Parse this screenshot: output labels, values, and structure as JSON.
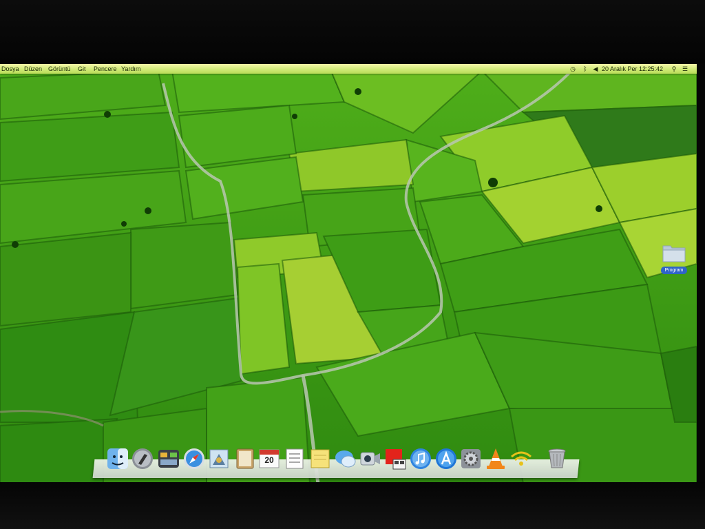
{
  "menubar": {
    "items": [
      "Dosya",
      "Düzen",
      "Görüntü",
      "Git",
      "Pencere",
      "Yardım"
    ],
    "clock": "20 Aralık Per  12:25:42"
  },
  "desktop": {
    "folder_label": "Program"
  },
  "dock": {
    "items": [
      {
        "name": "finder-icon"
      },
      {
        "name": "launchpad-icon"
      },
      {
        "name": "mission-control-icon"
      },
      {
        "name": "safari-icon"
      },
      {
        "name": "mail-icon"
      },
      {
        "name": "contacts-icon"
      },
      {
        "name": "calendar-icon",
        "label": "20"
      },
      {
        "name": "reminders-icon"
      },
      {
        "name": "notes-icon"
      },
      {
        "name": "messages-icon"
      },
      {
        "name": "facetime-icon"
      },
      {
        "name": "photo-booth-icon"
      },
      {
        "name": "itunes-icon"
      },
      {
        "name": "app-store-icon"
      },
      {
        "name": "system-preferences-icon"
      },
      {
        "name": "vlc-icon"
      },
      {
        "name": "wifi-icon"
      },
      {
        "name": "trash-icon"
      }
    ]
  },
  "colors": {
    "wallpaper_green": "#3e9a16",
    "menubar": "#cde873",
    "folder_blue": "#2f64c8"
  }
}
